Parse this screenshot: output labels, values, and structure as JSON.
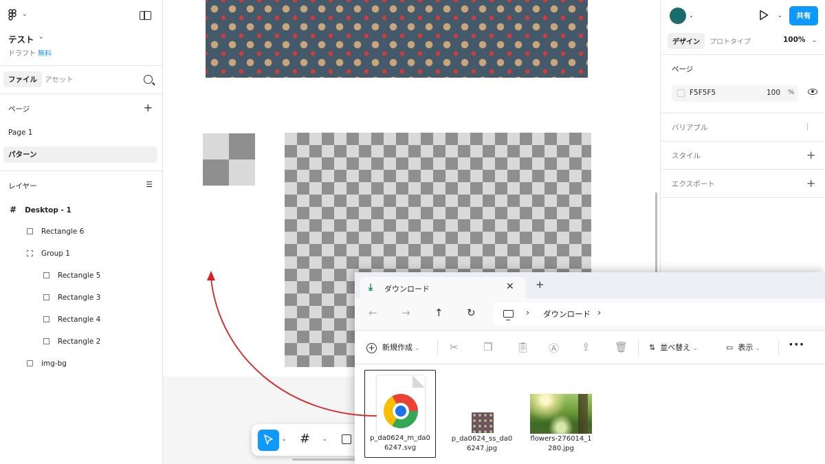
{
  "left_panel": {
    "file_title": "テスト",
    "draft_label": "ドラフト",
    "plan_label": "無料",
    "tabs": {
      "file": "ファイル",
      "assets": "アセット"
    },
    "pages_label": "ページ",
    "pages": [
      "Page 1",
      "パターン"
    ],
    "layers_label": "レイヤー",
    "layers": {
      "frame": "Desktop - 1",
      "rect6": "Rectangle 6",
      "group1": "Group 1",
      "rect5": "Rectangle 5",
      "rect3": "Rectangle 3",
      "rect4": "Rectangle 4",
      "rect2": "Rectangle 2",
      "imgbg": "img-bg"
    }
  },
  "right_panel": {
    "share_label": "共有",
    "tabs": {
      "design": "デザイン",
      "prototype": "プロトタイプ"
    },
    "zoom": "100%",
    "page_label": "ページ",
    "page_color": "F5F5F5",
    "page_opacity": "100",
    "opacity_unit": "%",
    "variables_label": "バリアブル",
    "styles_label": "スタイル",
    "export_label": "エクスポート",
    "accent_color": "#0d99ff"
  },
  "explorer": {
    "tab_title": "ダウンロード",
    "breadcrumb": "ダウンロード",
    "cmd_new": "新規作成",
    "cmd_sort": "並べ替え",
    "cmd_view": "表示",
    "files": [
      {
        "name": "p_da0624_m_da06247.svg",
        "line1": "p_da0624_m_da0",
        "line2": "6247.svg",
        "icon": "chrome-icon"
      },
      {
        "name": "p_da0624_ss_da06247.jpg",
        "line1": "p_da0624_ss_da0",
        "line2": "6247.jpg",
        "icon": "pattern-thumbnail"
      },
      {
        "name": "flowers-276014_1280.jpg",
        "line1": "flowers-276014_1",
        "line2": "280.jpg",
        "icon": "flowers-thumbnail"
      }
    ]
  },
  "annotation": {
    "arrow_color": "#dd1f1f"
  }
}
